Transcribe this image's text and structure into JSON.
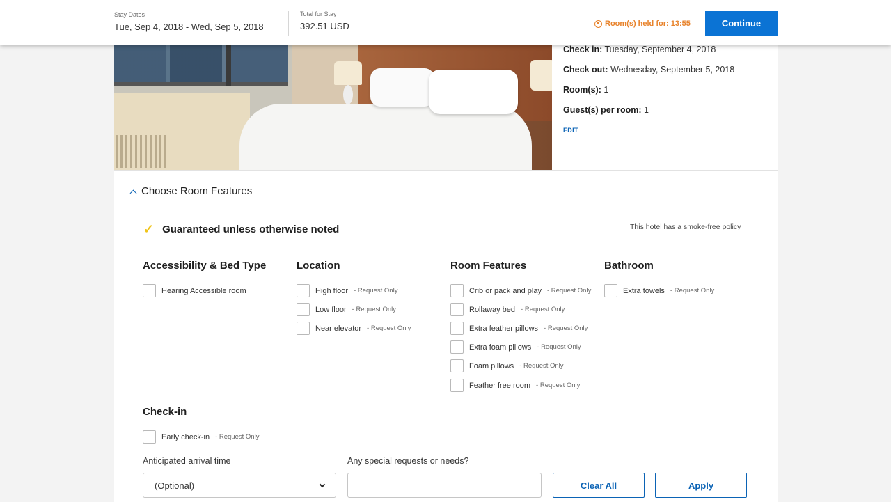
{
  "header": {
    "stay_dates_label": "Stay Dates",
    "stay_dates_value": "Tue, Sep 4, 2018 - Wed, Sep 5, 2018",
    "total_label": "Total for Stay",
    "total_value": "392.51 USD",
    "hold_text": "Room(s) held for: 13:55",
    "continue_label": "Continue",
    "colors": {
      "accent": "#0b73d4",
      "hold": "#e8822a"
    }
  },
  "booking": {
    "checkin_label": "Check in:",
    "checkin_value": "Tuesday, September 4, 2018",
    "checkout_label": "Check out:",
    "checkout_value": "Wednesday, September 5, 2018",
    "rooms_label": "Room(s):",
    "rooms_value": "1",
    "guests_label": "Guest(s) per room:",
    "guests_value": "1",
    "edit_label": "EDIT"
  },
  "features": {
    "section_title": "Choose Room Features",
    "guarantee_text": "Guaranteed unless otherwise noted",
    "smoke_policy": "This hotel has a smoke-free policy",
    "request_only": "- Request Only",
    "columns": [
      {
        "title": "Accessibility & Bed Type",
        "options": [
          {
            "label": "Hearing Accessible room",
            "request": ""
          }
        ]
      },
      {
        "title": "Location",
        "options": [
          {
            "label": "High floor",
            "request": "- Request Only"
          },
          {
            "label": "Low floor",
            "request": "- Request Only"
          },
          {
            "label": "Near elevator",
            "request": "- Request Only"
          }
        ]
      },
      {
        "title": "Room Features",
        "options": [
          {
            "label": "Crib or pack and play",
            "request": "- Request Only"
          },
          {
            "label": "Rollaway bed",
            "request": "- Request Only"
          },
          {
            "label": "Extra feather pillows",
            "request": "- Request Only"
          },
          {
            "label": "Extra foam pillows",
            "request": "- Request Only"
          },
          {
            "label": "Foam pillows",
            "request": "- Request Only"
          },
          {
            "label": "Feather free room",
            "request": "- Request Only"
          }
        ]
      },
      {
        "title": "Bathroom",
        "options": [
          {
            "label": "Extra towels",
            "request": "- Request Only"
          }
        ]
      }
    ],
    "checkin_title": "Check-in",
    "checkin_options": [
      {
        "label": "Early check-in",
        "request": "- Request Only"
      }
    ],
    "arrival_label": "Anticipated arrival time",
    "arrival_value": "(Optional)",
    "special_label": "Any special requests or needs?",
    "special_value": "",
    "clear_label": "Clear All",
    "apply_label": "Apply"
  }
}
